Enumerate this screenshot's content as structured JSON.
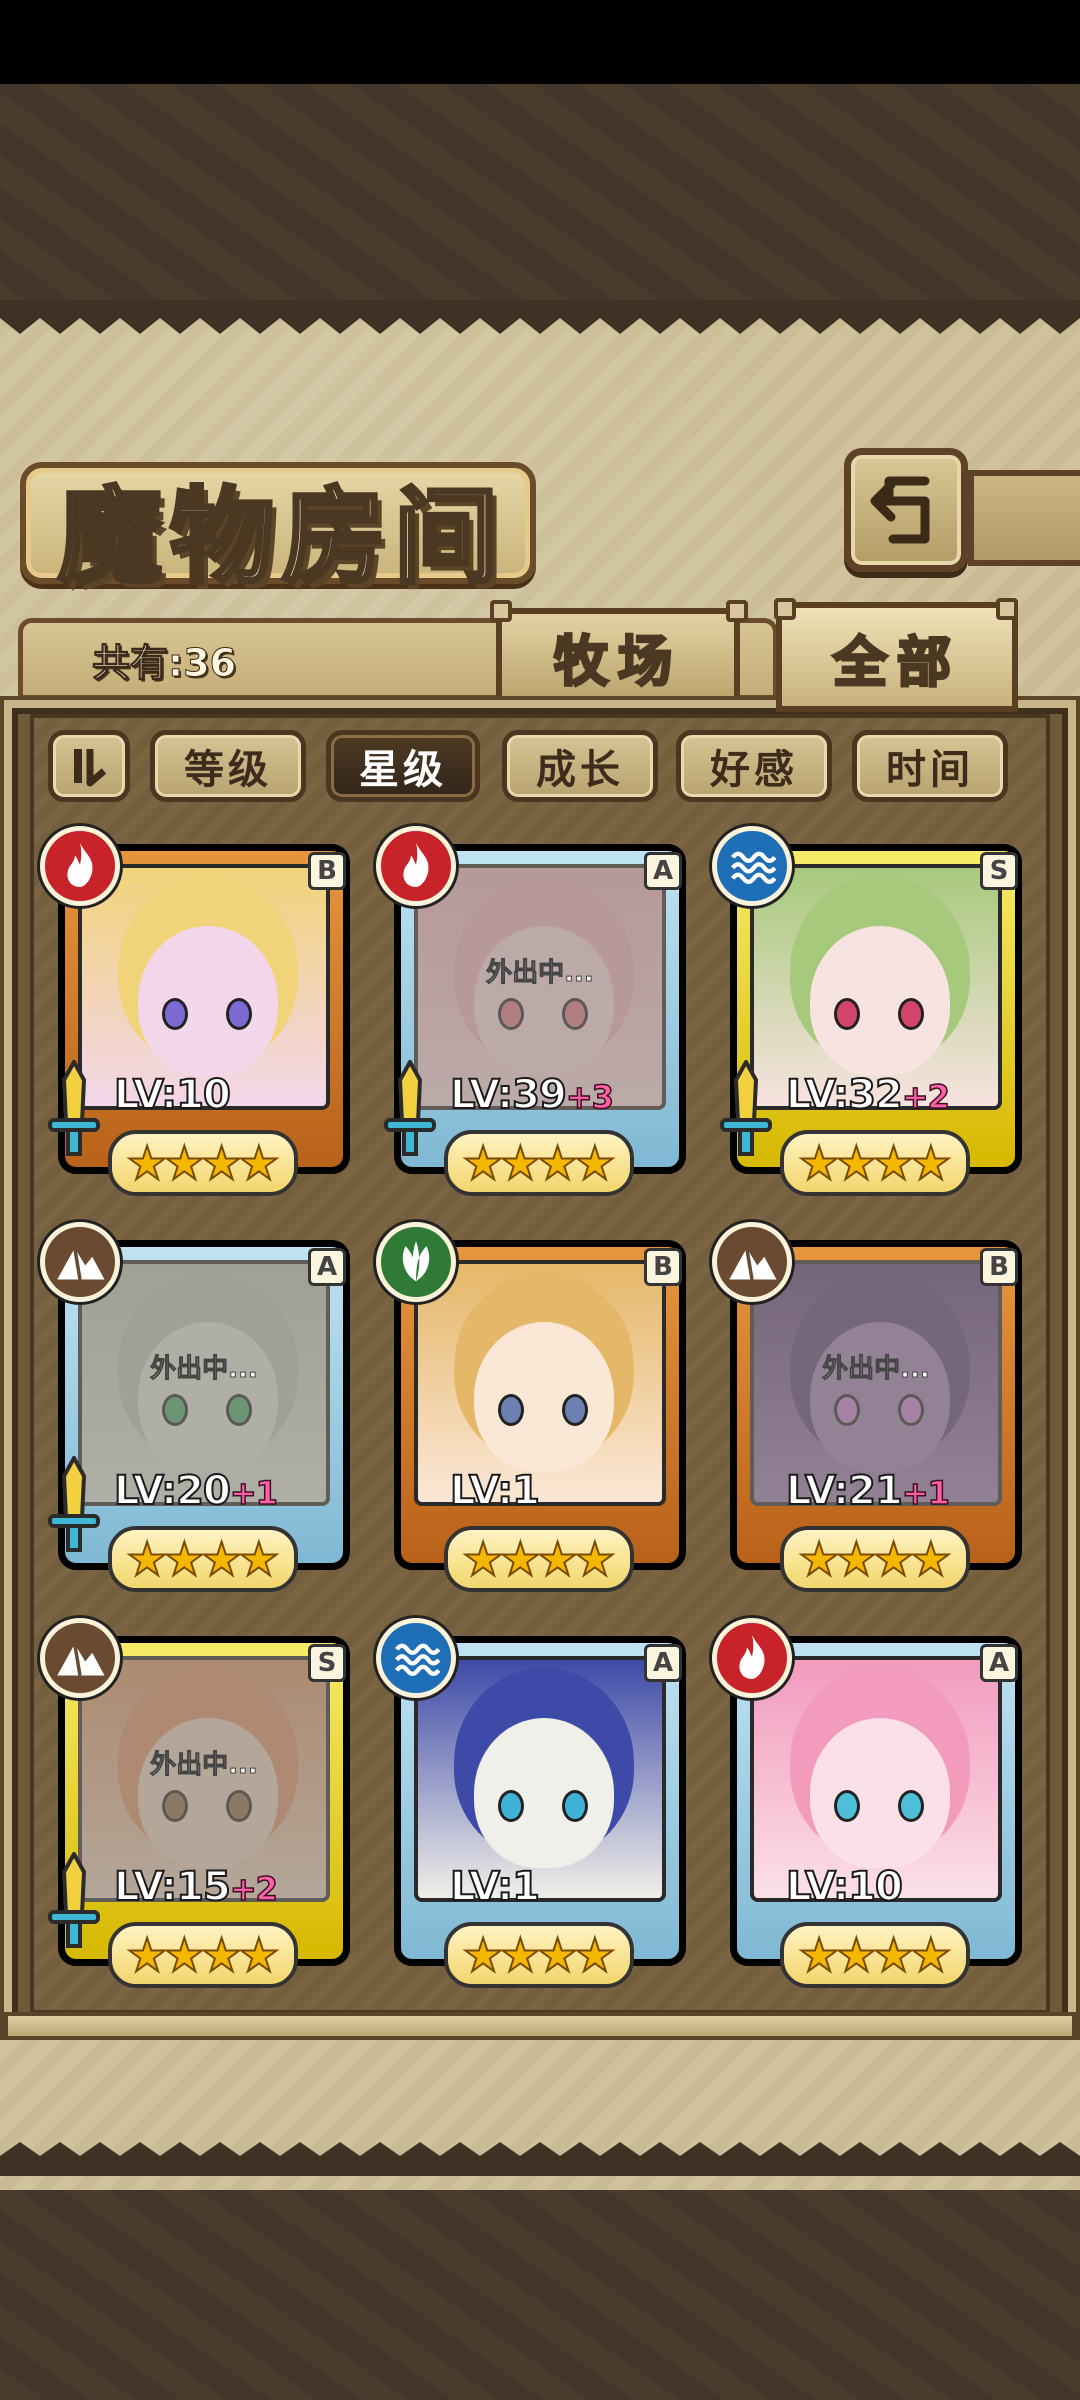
{
  "header": {
    "title": "魔物房间",
    "back_icon": "back-arrow-icon"
  },
  "summary": {
    "count_text": "共有:36"
  },
  "tabs": [
    {
      "label": "牧场",
      "active": false
    },
    {
      "label": "全部",
      "active": true
    }
  ],
  "sort": {
    "toggle_icon": "sort-order-icon",
    "buttons": [
      {
        "label": "等级",
        "active": false
      },
      {
        "label": "星级",
        "active": true
      },
      {
        "label": "成长",
        "active": false
      },
      {
        "label": "好感",
        "active": false
      },
      {
        "label": "时间",
        "active": false
      }
    ]
  },
  "monsters": [
    {
      "rank": "B",
      "element": "fire-icon",
      "level": "LV:10",
      "bonus": "",
      "stars": 4,
      "status": "",
      "weapon_icon": "sword-icon"
    },
    {
      "rank": "A",
      "element": "fire-icon",
      "level": "LV:39",
      "bonus": "+3",
      "stars": 4,
      "status": "外出中...",
      "weapon_icon": "sword-icon"
    },
    {
      "rank": "S",
      "element": "water-icon",
      "level": "LV:32",
      "bonus": "+2",
      "stars": 4,
      "status": "",
      "weapon_icon": "sword-icon"
    },
    {
      "rank": "A",
      "element": "earth-icon",
      "level": "LV:20",
      "bonus": "+1",
      "stars": 4,
      "status": "外出中...",
      "weapon_icon": "sword-icon"
    },
    {
      "rank": "B",
      "element": "leaf-icon",
      "level": "LV:1",
      "bonus": "",
      "stars": 4,
      "status": "",
      "weapon_icon": ""
    },
    {
      "rank": "B",
      "element": "earth-icon",
      "level": "LV:21",
      "bonus": "+1",
      "stars": 4,
      "status": "外出中...",
      "weapon_icon": ""
    },
    {
      "rank": "S",
      "element": "earth-icon",
      "level": "LV:15",
      "bonus": "+2",
      "stars": 4,
      "status": "外出中...",
      "weapon_icon": "sword-icon"
    },
    {
      "rank": "A",
      "element": "water-icon",
      "level": "LV:1",
      "bonus": "",
      "stars": 4,
      "status": "",
      "weapon_icon": ""
    },
    {
      "rank": "A",
      "element": "fire-icon",
      "level": "LV:10",
      "bonus": "",
      "stars": 4,
      "status": "",
      "weapon_icon": ""
    }
  ],
  "colors": {
    "fire": "#c8222a",
    "water": "#1f6fb8",
    "earth": "#6b4a32",
    "leaf": "#2f7b36"
  }
}
